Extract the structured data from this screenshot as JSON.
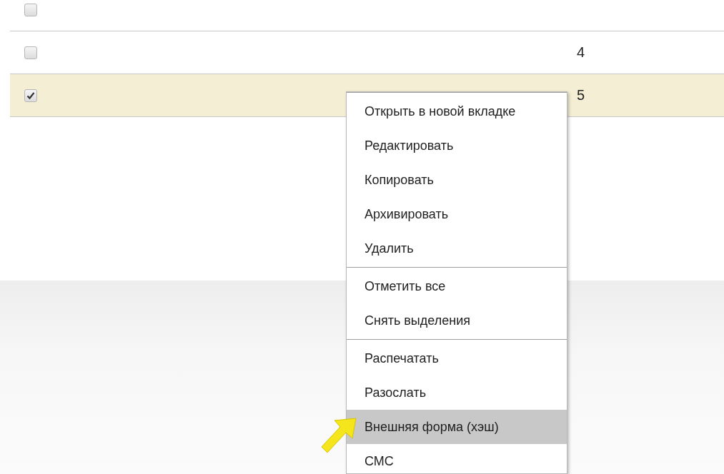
{
  "table": {
    "rows": [
      {
        "checked": false,
        "selected": false
      },
      {
        "checked": false,
        "selected": false,
        "number": "4"
      },
      {
        "checked": true,
        "selected": true,
        "number": "5"
      }
    ]
  },
  "context_menu": {
    "groups": [
      {
        "items": [
          {
            "label": "Открыть в новой вкладке",
            "selected": false
          },
          {
            "label": "Редактировать",
            "selected": false
          },
          {
            "label": "Копировать",
            "selected": false
          },
          {
            "label": "Архивировать",
            "selected": false
          },
          {
            "label": "Удалить",
            "selected": false
          }
        ]
      },
      {
        "items": [
          {
            "label": "Отметить все",
            "selected": false
          },
          {
            "label": "Снять выделения",
            "selected": false
          }
        ]
      },
      {
        "items": [
          {
            "label": "Распечатать",
            "selected": false
          },
          {
            "label": "Разослать",
            "selected": false
          },
          {
            "label": "Внешняя форма (хэш)",
            "selected": true
          },
          {
            "label": "СМС",
            "selected": false
          }
        ]
      }
    ]
  }
}
